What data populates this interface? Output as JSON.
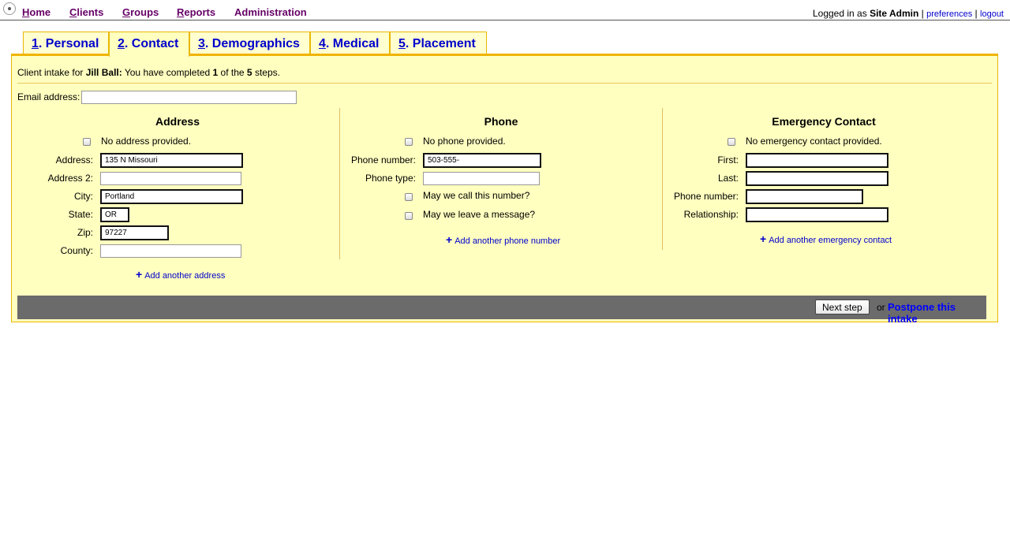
{
  "nav": {
    "home": {
      "u": "H",
      "rest": "ome"
    },
    "clients": {
      "u": "C",
      "rest": "lients"
    },
    "groups": {
      "u": "G",
      "rest": "roups"
    },
    "reports": {
      "u": "R",
      "rest": "eports"
    },
    "administration": "Administration"
  },
  "login": {
    "prefix": "Logged in as",
    "user": "Site Admin",
    "sep1": "|",
    "preferences": "preferences",
    "sep2": "|",
    "logout": "logout"
  },
  "tabs": [
    {
      "num": "1",
      "label": ". Personal"
    },
    {
      "num": "2",
      "label": ". Contact"
    },
    {
      "num": "3",
      "label": ". Demographics"
    },
    {
      "num": "4",
      "label": ". Medical"
    },
    {
      "num": "5",
      "label": ". Placement"
    }
  ],
  "intro": {
    "prefix": "Client intake for",
    "client": "Jill Ball:",
    "mid1": "You have completed",
    "done": "1",
    "mid2": "of the",
    "total": "5",
    "suffix": "steps."
  },
  "email": {
    "label": "Email address:",
    "value": ""
  },
  "address": {
    "heading": "Address",
    "none_label": "No address provided.",
    "address_label": "Address:",
    "address_value": "135 N Missouri",
    "address2_label": "Address 2:",
    "address2_value": "",
    "city_label": "City:",
    "city_value": "Portland",
    "state_label": "State:",
    "state_value": "OR",
    "zip_label": "Zip:",
    "zip_value": "97227",
    "county_label": "County:",
    "county_value": "",
    "add_link": "Add another address"
  },
  "phone": {
    "heading": "Phone",
    "none_label": "No phone provided.",
    "number_label": "Phone number:",
    "number_value": "503-555-",
    "type_label": "Phone type:",
    "type_value": "",
    "call_label": "May we call this number?",
    "message_label": "May we leave a message?",
    "add_link": "Add another phone number"
  },
  "emergency": {
    "heading": "Emergency Contact",
    "none_label": "No emergency contact provided.",
    "first_label": "First:",
    "first_value": "",
    "last_label": "Last:",
    "last_value": "",
    "phone_label": "Phone number:",
    "phone_value": "",
    "relationship_label": "Relationship:",
    "relationship_value": "",
    "add_link": "Add another emergency contact"
  },
  "footer": {
    "next_step": "Next step",
    "or": "or",
    "postpone": "Postpone this intake"
  },
  "colors": {
    "panel_bg": "#ffffc0",
    "panel_border": "#e8b800",
    "nav_text": "#660066",
    "link": "#0000cc",
    "footer_bar": "#6b6b6b"
  },
  "icons": {
    "logo": "app-logo-icon",
    "add": "plus-icon"
  }
}
